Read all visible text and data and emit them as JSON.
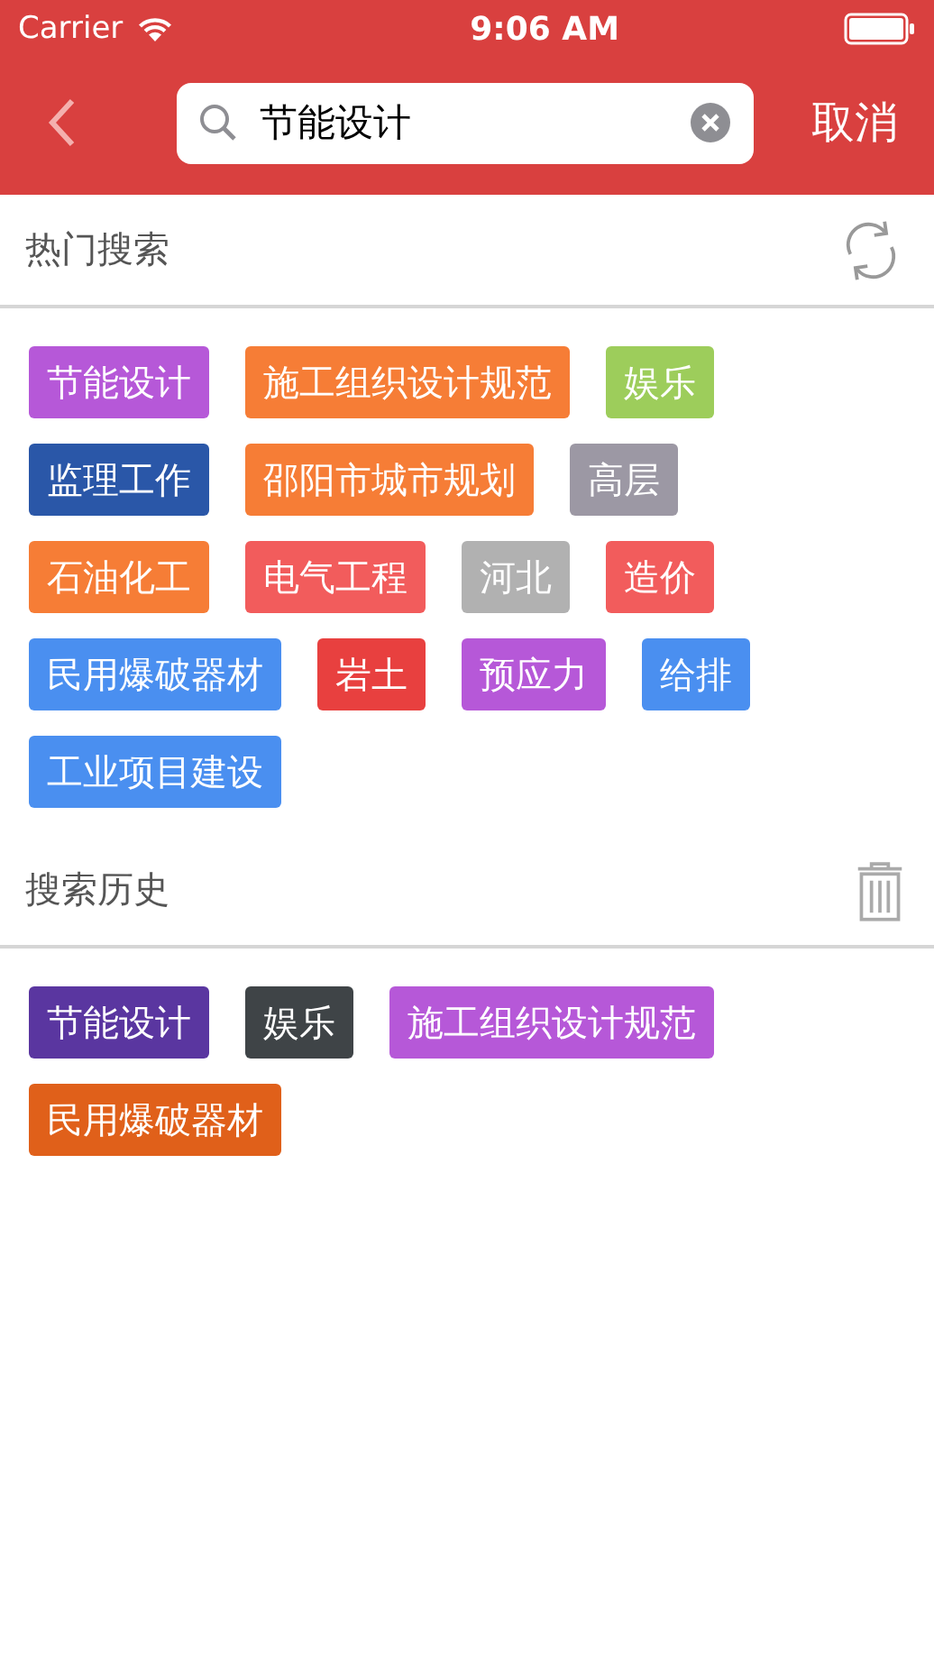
{
  "status_bar": {
    "carrier": "Carrier",
    "time": "9:06 AM"
  },
  "search": {
    "value": "节能设计",
    "cancel": "取消"
  },
  "hot": {
    "title": "热门搜索",
    "tags": [
      {
        "label": "节能设计",
        "color": "#b658d8"
      },
      {
        "label": "施工组织设计规范",
        "color": "#f67d36"
      },
      {
        "label": "娱乐",
        "color": "#9dcd5b"
      },
      {
        "label": "监理工作",
        "color": "#2a57a8"
      },
      {
        "label": "邵阳市城市规划",
        "color": "#f67d36"
      },
      {
        "label": "高层",
        "color": "#9c98a4"
      },
      {
        "label": "石油化工",
        "color": "#f67d36"
      },
      {
        "label": "电气工程",
        "color": "#f25c5c"
      },
      {
        "label": "河北",
        "color": "#b1b1b1"
      },
      {
        "label": "造价",
        "color": "#f25c5c"
      },
      {
        "label": "民用爆破器材",
        "color": "#4a8ff0"
      },
      {
        "label": "岩土",
        "color": "#e8403f"
      },
      {
        "label": "预应力",
        "color": "#b658d8"
      },
      {
        "label": "给排",
        "color": "#4a8ff0"
      },
      {
        "label": "工业项目建设",
        "color": "#4a8ff0"
      }
    ]
  },
  "history": {
    "title": "搜索历史",
    "tags": [
      {
        "label": "节能设计",
        "color": "#5a36a0"
      },
      {
        "label": "娱乐",
        "color": "#3f4447"
      },
      {
        "label": "施工组织设计规范",
        "color": "#b658d8"
      },
      {
        "label": "民用爆破器材",
        "color": "#e0601a"
      }
    ]
  }
}
